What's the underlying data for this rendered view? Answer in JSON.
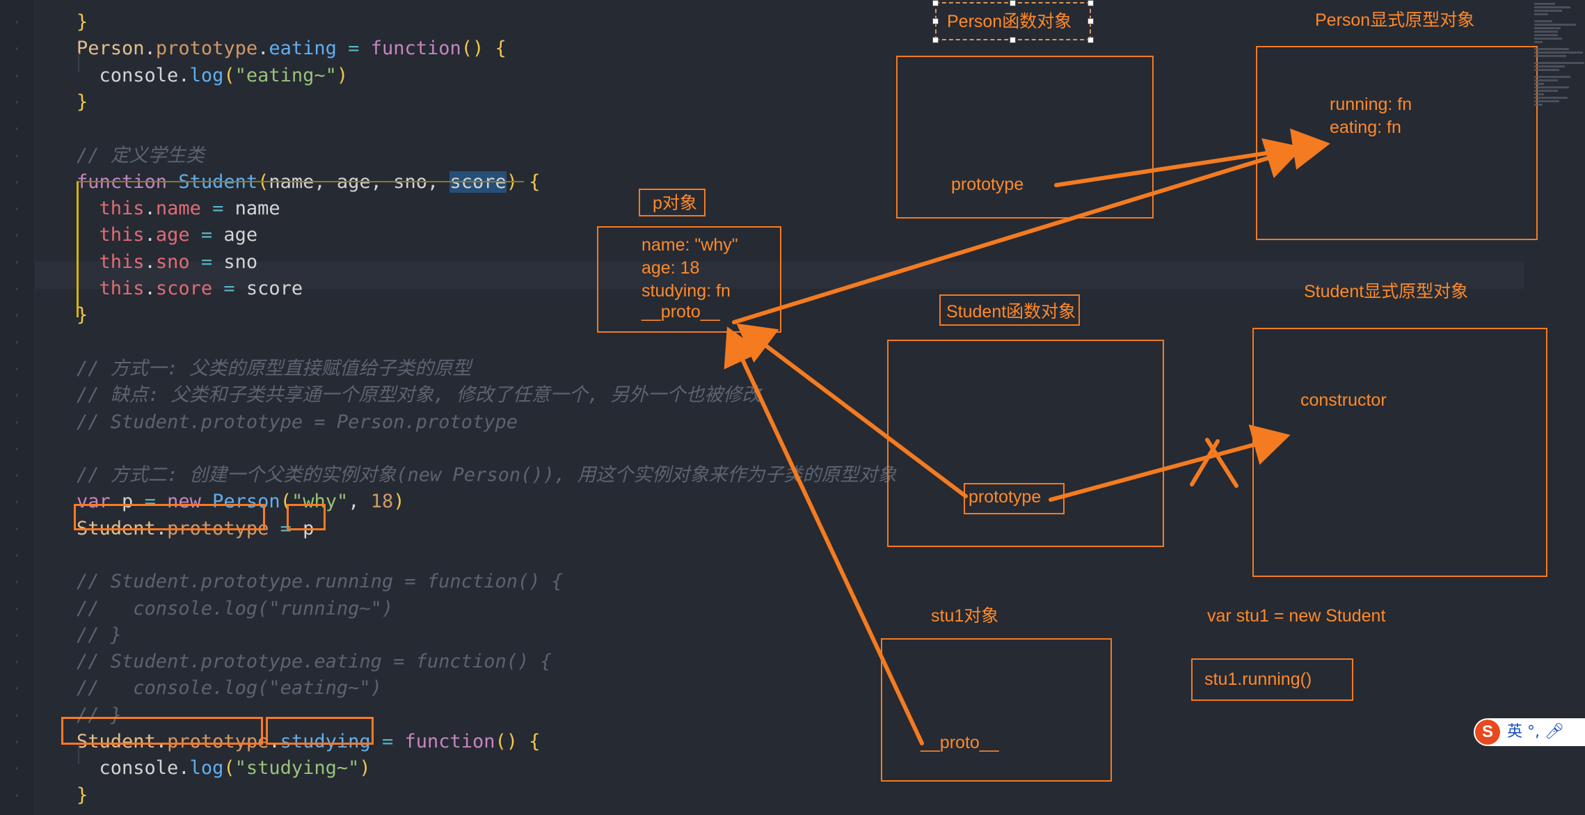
{
  "code": {
    "lines": [
      [
        {
          "t": "}",
          "c": "brace"
        }
      ],
      [
        {
          "t": "Person",
          "c": "fn"
        },
        {
          "t": ".",
          "c": "plain"
        },
        {
          "t": "prototype",
          "c": "var"
        },
        {
          "t": ".",
          "c": "plain"
        },
        {
          "t": "eating",
          "c": "prop"
        },
        {
          "t": " = ",
          "c": "op"
        },
        {
          "t": "function",
          "c": "kw"
        },
        {
          "t": "() ",
          "c": "paren"
        },
        {
          "t": "{",
          "c": "brace"
        }
      ],
      [
        {
          "t": "  console.",
          "c": "plain"
        },
        {
          "t": "log",
          "c": "prop"
        },
        {
          "t": "(",
          "c": "paren"
        },
        {
          "t": "\"eating~\"",
          "c": "str"
        },
        {
          "t": ")",
          "c": "paren"
        }
      ],
      [
        {
          "t": "}",
          "c": "brace"
        }
      ],
      [],
      [
        {
          "t": "// 定义学生类",
          "c": "cmt"
        }
      ],
      [
        {
          "t": "function",
          "c": "kw"
        },
        {
          "t": " ",
          "c": "plain"
        },
        {
          "t": "Student",
          "c": "prop"
        },
        {
          "t": "(",
          "c": "paren"
        },
        {
          "t": "name, age, sno, ",
          "c": "plain"
        },
        {
          "t": "score",
          "c": "hl"
        },
        {
          "t": ") ",
          "c": "paren"
        },
        {
          "t": "{",
          "c": "brace"
        }
      ],
      [
        {
          "t": "  ",
          "c": "plain"
        },
        {
          "t": "this",
          "c": "this"
        },
        {
          "t": ".",
          "c": "plain"
        },
        {
          "t": "name",
          "c": "this"
        },
        {
          "t": " = ",
          "c": "op"
        },
        {
          "t": "name",
          "c": "plain"
        }
      ],
      [
        {
          "t": "  ",
          "c": "plain"
        },
        {
          "t": "this",
          "c": "this"
        },
        {
          "t": ".",
          "c": "plain"
        },
        {
          "t": "age",
          "c": "this"
        },
        {
          "t": " = ",
          "c": "op"
        },
        {
          "t": "age",
          "c": "plain"
        }
      ],
      [
        {
          "t": "  ",
          "c": "plain"
        },
        {
          "t": "this",
          "c": "this"
        },
        {
          "t": ".",
          "c": "plain"
        },
        {
          "t": "sno",
          "c": "this"
        },
        {
          "t": " = ",
          "c": "op"
        },
        {
          "t": "sno",
          "c": "plain"
        }
      ],
      [
        {
          "t": "  ",
          "c": "plain"
        },
        {
          "t": "this",
          "c": "this"
        },
        {
          "t": ".",
          "c": "plain"
        },
        {
          "t": "score",
          "c": "this"
        },
        {
          "t": " = ",
          "c": "op"
        },
        {
          "t": "score",
          "c": "plain"
        }
      ],
      [
        {
          "t": "}",
          "c": "brace"
        }
      ],
      [],
      [
        {
          "t": "// 方式一: 父类的原型直接赋值给子类的原型",
          "c": "cmt"
        }
      ],
      [
        {
          "t": "// 缺点: 父类和子类共享通一个原型对象, 修改了任意一个, 另外一个也被修改",
          "c": "cmt"
        }
      ],
      [
        {
          "t": "// Student.prototype = Person.prototype",
          "c": "cmt"
        }
      ],
      [],
      [
        {
          "t": "// 方式二: 创建一个父类的实例对象(new Person()), 用这个实例对象来作为子类的原型对象",
          "c": "cmt"
        }
      ],
      [
        {
          "t": "var",
          "c": "kw"
        },
        {
          "t": " p ",
          "c": "plain"
        },
        {
          "t": "=",
          "c": "op"
        },
        {
          "t": " ",
          "c": "plain"
        },
        {
          "t": "new",
          "c": "kw"
        },
        {
          "t": " ",
          "c": "plain"
        },
        {
          "t": "Person",
          "c": "prop"
        },
        {
          "t": "(",
          "c": "paren"
        },
        {
          "t": "\"why\"",
          "c": "str"
        },
        {
          "t": ", ",
          "c": "plain"
        },
        {
          "t": "18",
          "c": "num"
        },
        {
          "t": ")",
          "c": "paren"
        }
      ],
      [
        {
          "t": "Student",
          "c": "fn"
        },
        {
          "t": ".",
          "c": "plain"
        },
        {
          "t": "prototype",
          "c": "var"
        },
        {
          "t": " = ",
          "c": "op"
        },
        {
          "t": "p",
          "c": "plain"
        }
      ],
      [],
      [
        {
          "t": "// Student.prototype.running = function() {",
          "c": "cmt"
        }
      ],
      [
        {
          "t": "//   console.log(\"running~\")",
          "c": "cmt"
        }
      ],
      [
        {
          "t": "// }",
          "c": "cmt"
        }
      ],
      [
        {
          "t": "// Student.prototype.eating = function() {",
          "c": "cmt"
        }
      ],
      [
        {
          "t": "//   console.log(\"eating~\")",
          "c": "cmt"
        }
      ],
      [
        {
          "t": "// }",
          "c": "cmt"
        }
      ],
      [
        {
          "t": "Student",
          "c": "fn"
        },
        {
          "t": ".",
          "c": "plain"
        },
        {
          "t": "prototype",
          "c": "var"
        },
        {
          "t": ".",
          "c": "plain"
        },
        {
          "t": "studying",
          "c": "prop"
        },
        {
          "t": " = ",
          "c": "op"
        },
        {
          "t": "function",
          "c": "kw"
        },
        {
          "t": "() ",
          "c": "paren"
        },
        {
          "t": "{",
          "c": "brace"
        }
      ],
      [
        {
          "t": "  console.",
          "c": "plain"
        },
        {
          "t": "log",
          "c": "prop"
        },
        {
          "t": "(",
          "c": "paren"
        },
        {
          "t": "\"studying~\"",
          "c": "str"
        },
        {
          "t": ")",
          "c": "paren"
        }
      ],
      [
        {
          "t": "}",
          "c": "brace"
        }
      ]
    ]
  },
  "diagram": {
    "person_func_label": "Person函数对象",
    "person_func_prototype": "prototype",
    "person_proto_label": "Person显式原型对象",
    "person_proto_props": [
      "running: fn",
      "eating: fn"
    ],
    "p_obj_label": "p对象",
    "p_obj_props": [
      "name: \"why\"",
      "age: 18",
      "studying: fn",
      " __proto__"
    ],
    "student_func_label": "Student函数对象",
    "student_func_prototype": "prototype",
    "student_proto_label": "Student显式原型对象",
    "student_proto_constructor": "constructor",
    "stu1_label": "stu1对象",
    "stu1_proto": "__proto__",
    "stu1_note": "var stu1 = new Student",
    "stu1_call": "stu1.running()"
  },
  "ime": {
    "lang": "英",
    "punct": "°,"
  },
  "colors": {
    "accent": "#f47b20",
    "editor_bg": "#262a33"
  }
}
